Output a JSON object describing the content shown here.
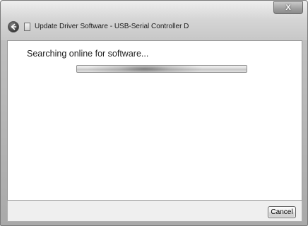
{
  "window": {
    "title": "Update Driver Software - USB-Serial Controller D",
    "close_label": "X"
  },
  "main": {
    "heading": "Searching online for software...",
    "progress_state": "indeterminate"
  },
  "footer": {
    "cancel_label": "Cancel"
  },
  "icons": {
    "back": "back-arrow-icon",
    "app": "driver-icon",
    "close": "close-icon"
  },
  "colors": {
    "window_frame": "#bfbfbf",
    "content_bg": "#ffffff",
    "footer_bg": "#efefef"
  }
}
